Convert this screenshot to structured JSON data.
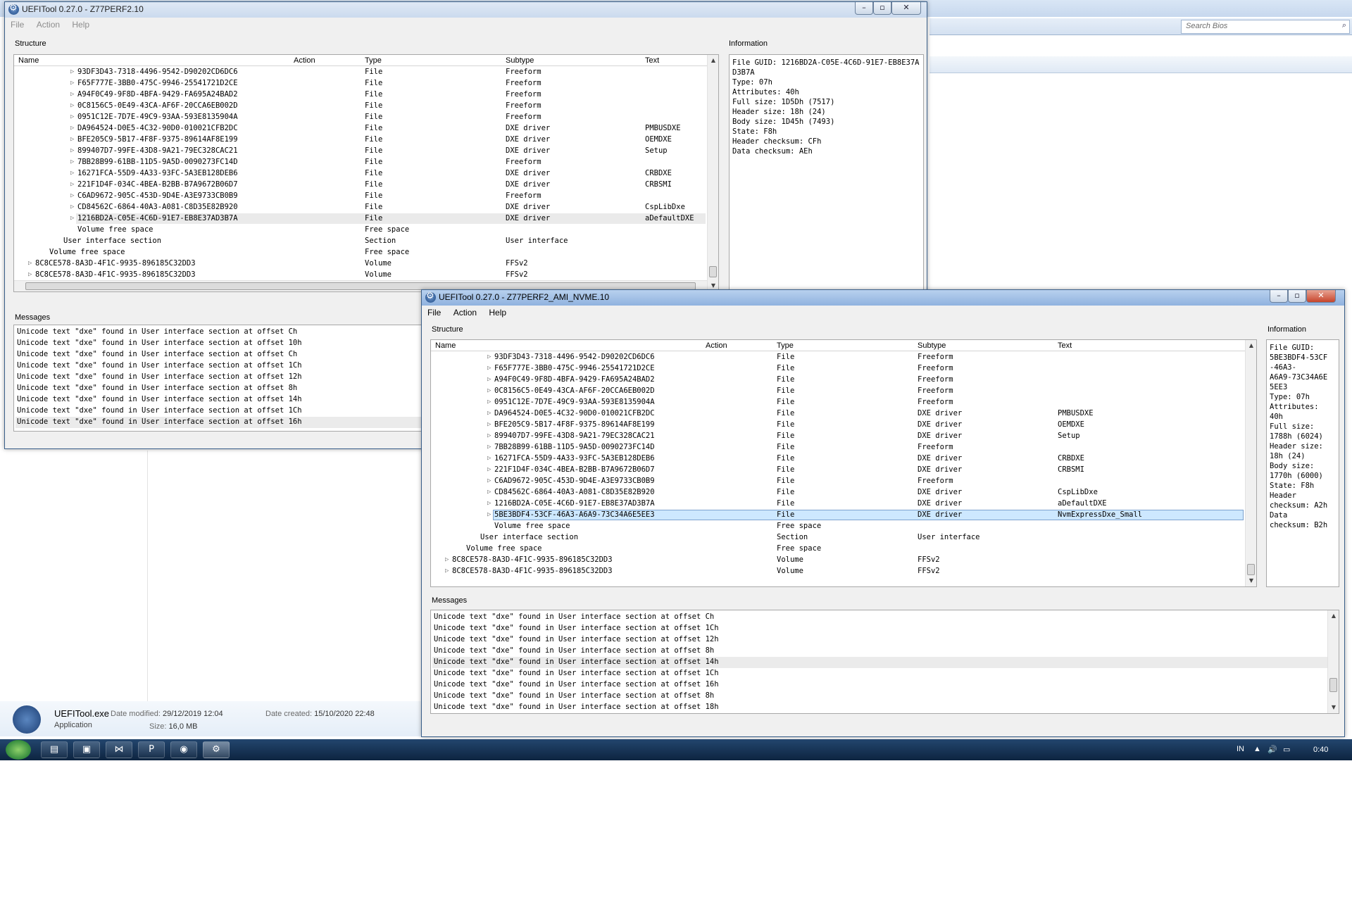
{
  "explorer": {
    "search_placeholder": "Search Bios",
    "details": {
      "file_name": "UEFITool.exe",
      "date_modified_label": "Date modified:",
      "date_modified": "29/12/2019 12:04",
      "date_created_label": "Date created:",
      "date_created": "15/10/2020 22:48",
      "file_type": "Application",
      "size_label": "Size:",
      "size": "16,0 MB"
    }
  },
  "window_back": {
    "title": "UEFITool 0.27.0 - Z77PERF2.10",
    "menu": [
      "File",
      "Action",
      "Help"
    ],
    "structure_label": "Structure",
    "information_label": "Information",
    "messages_label": "Messages",
    "columns": [
      "Name",
      "Action",
      "Type",
      "Subtype",
      "Text"
    ],
    "rows": [
      {
        "indent": 4,
        "exp": true,
        "name": "93DF3D43-7318-4496-9542-D90202CD6DC6",
        "type": "File",
        "subtype": "Freeform",
        "text": ""
      },
      {
        "indent": 4,
        "exp": true,
        "name": "F65F777E-3BB0-475C-9946-25541721D2CE",
        "type": "File",
        "subtype": "Freeform",
        "text": ""
      },
      {
        "indent": 4,
        "exp": true,
        "name": "A94F0C49-9F8D-4BFA-9429-FA695A24BAD2",
        "type": "File",
        "subtype": "Freeform",
        "text": ""
      },
      {
        "indent": 4,
        "exp": true,
        "name": "0C8156C5-0E49-43CA-AF6F-20CCA6EB002D",
        "type": "File",
        "subtype": "Freeform",
        "text": ""
      },
      {
        "indent": 4,
        "exp": true,
        "name": "0951C12E-7D7E-49C9-93AA-593E8135904A",
        "type": "File",
        "subtype": "Freeform",
        "text": ""
      },
      {
        "indent": 4,
        "exp": true,
        "name": "DA964524-D0E5-4C32-90D0-010021CFB2DC",
        "type": "File",
        "subtype": "DXE driver",
        "text": "PMBUSDXE"
      },
      {
        "indent": 4,
        "exp": true,
        "name": "BFE205C9-5B17-4F8F-9375-89614AF8E199",
        "type": "File",
        "subtype": "DXE driver",
        "text": "OEMDXE"
      },
      {
        "indent": 4,
        "exp": true,
        "name": "899407D7-99FE-43D8-9A21-79EC328CAC21",
        "type": "File",
        "subtype": "DXE driver",
        "text": "Setup"
      },
      {
        "indent": 4,
        "exp": true,
        "name": "7BB28B99-61BB-11D5-9A5D-0090273FC14D",
        "type": "File",
        "subtype": "Freeform",
        "text": ""
      },
      {
        "indent": 4,
        "exp": true,
        "name": "16271FCA-55D9-4A33-93FC-5A3EB128DEB6",
        "type": "File",
        "subtype": "DXE driver",
        "text": "CRBDXE"
      },
      {
        "indent": 4,
        "exp": true,
        "name": "221F1D4F-034C-4BEA-B2BB-B7A9672B06D7",
        "type": "File",
        "subtype": "DXE driver",
        "text": "CRBSMI"
      },
      {
        "indent": 4,
        "exp": true,
        "name": "C6AD9672-905C-453D-9D4E-A3E9733CB0B9",
        "type": "File",
        "subtype": "Freeform",
        "text": ""
      },
      {
        "indent": 4,
        "exp": true,
        "name": "CD84562C-6864-40A3-A081-C8D35E82B920",
        "type": "File",
        "subtype": "DXE driver",
        "text": "CspLibDxe"
      },
      {
        "indent": 4,
        "exp": true,
        "name": "1216BD2A-C05E-4C6D-91E7-EB8E37AD3B7A",
        "type": "File",
        "subtype": "DXE driver",
        "text": "aDefaultDXE",
        "selected": true
      },
      {
        "indent": 4,
        "exp": false,
        "name": "Volume free space",
        "type": "Free space",
        "subtype": "",
        "text": ""
      },
      {
        "indent": 3,
        "exp": false,
        "name": "User interface section",
        "type": "Section",
        "subtype": "User interface",
        "text": ""
      },
      {
        "indent": 2,
        "exp": false,
        "name": "Volume free space",
        "type": "Free space",
        "subtype": "",
        "text": ""
      },
      {
        "indent": 1,
        "exp": true,
        "name": "8C8CE578-8A3D-4F1C-9935-896185C32DD3",
        "type": "Volume",
        "subtype": "FFSv2",
        "text": ""
      },
      {
        "indent": 1,
        "exp": true,
        "name": "8C8CE578-8A3D-4F1C-9935-896185C32DD3",
        "type": "Volume",
        "subtype": "FFSv2",
        "text": ""
      }
    ],
    "information": "File GUID: 1216BD2A-C05E-4C6D-91E7-EB8E37AD3B7A\nType: 07h\nAttributes: 40h\nFull size: 1D5Dh (7517)\nHeader size: 18h (24)\nBody size: 1D45h (7493)\nState: F8h\nHeader checksum: CFh\nData checksum: AEh",
    "messages": [
      "Unicode text \"dxe\" found in User interface section at offset Ch",
      "Unicode text \"dxe\" found in User interface section at offset 10h",
      "Unicode text \"dxe\" found in User interface section at offset Ch",
      "Unicode text \"dxe\" found in User interface section at offset 1Ch",
      "Unicode text \"dxe\" found in User interface section at offset 12h",
      "Unicode text \"dxe\" found in User interface section at offset 8h",
      "Unicode text \"dxe\" found in User interface section at offset 14h",
      "Unicode text \"dxe\" found in User interface section at offset 1Ch",
      "Unicode text \"dxe\" found in User interface section at offset 16h"
    ],
    "messages_highlight_index": 8
  },
  "window_front": {
    "title": "UEFITool 0.27.0 - Z77PERF2_AMI_NVME.10",
    "menu": [
      "File",
      "Action",
      "Help"
    ],
    "structure_label": "Structure",
    "information_label": "Information",
    "messages_label": "Messages",
    "columns": [
      "Name",
      "Action",
      "Type",
      "Subtype",
      "Text"
    ],
    "rows": [
      {
        "indent": 4,
        "exp": true,
        "name": "93DF3D43-7318-4496-9542-D90202CD6DC6",
        "type": "File",
        "subtype": "Freeform",
        "text": ""
      },
      {
        "indent": 4,
        "exp": true,
        "name": "F65F777E-3BB0-475C-9946-25541721D2CE",
        "type": "File",
        "subtype": "Freeform",
        "text": ""
      },
      {
        "indent": 4,
        "exp": true,
        "name": "A94F0C49-9F8D-4BFA-9429-FA695A24BAD2",
        "type": "File",
        "subtype": "Freeform",
        "text": ""
      },
      {
        "indent": 4,
        "exp": true,
        "name": "0C8156C5-0E49-43CA-AF6F-20CCA6EB002D",
        "type": "File",
        "subtype": "Freeform",
        "text": ""
      },
      {
        "indent": 4,
        "exp": true,
        "name": "0951C12E-7D7E-49C9-93AA-593E8135904A",
        "type": "File",
        "subtype": "Freeform",
        "text": ""
      },
      {
        "indent": 4,
        "exp": true,
        "name": "DA964524-D0E5-4C32-90D0-010021CFB2DC",
        "type": "File",
        "subtype": "DXE driver",
        "text": "PMBUSDXE"
      },
      {
        "indent": 4,
        "exp": true,
        "name": "BFE205C9-5B17-4F8F-9375-89614AF8E199",
        "type": "File",
        "subtype": "DXE driver",
        "text": "OEMDXE"
      },
      {
        "indent": 4,
        "exp": true,
        "name": "899407D7-99FE-43D8-9A21-79EC328CAC21",
        "type": "File",
        "subtype": "DXE driver",
        "text": "Setup"
      },
      {
        "indent": 4,
        "exp": true,
        "name": "7BB28B99-61BB-11D5-9A5D-0090273FC14D",
        "type": "File",
        "subtype": "Freeform",
        "text": ""
      },
      {
        "indent": 4,
        "exp": true,
        "name": "16271FCA-55D9-4A33-93FC-5A3EB128DEB6",
        "type": "File",
        "subtype": "DXE driver",
        "text": "CRBDXE"
      },
      {
        "indent": 4,
        "exp": true,
        "name": "221F1D4F-034C-4BEA-B2BB-B7A9672B06D7",
        "type": "File",
        "subtype": "DXE driver",
        "text": "CRBSMI"
      },
      {
        "indent": 4,
        "exp": true,
        "name": "C6AD9672-905C-453D-9D4E-A3E9733CB0B9",
        "type": "File",
        "subtype": "Freeform",
        "text": ""
      },
      {
        "indent": 4,
        "exp": true,
        "name": "CD84562C-6864-40A3-A081-C8D35E82B920",
        "type": "File",
        "subtype": "DXE driver",
        "text": "CspLibDxe"
      },
      {
        "indent": 4,
        "exp": true,
        "name": "1216BD2A-C05E-4C6D-91E7-EB8E37AD3B7A",
        "type": "File",
        "subtype": "DXE driver",
        "text": "aDefaultDXE"
      },
      {
        "indent": 4,
        "exp": true,
        "name": "5BE3BDF4-53CF-46A3-A6A9-73C34A6E5EE3",
        "type": "File",
        "subtype": "DXE driver",
        "text": "NvmExpressDxe_Small",
        "selected": true
      },
      {
        "indent": 4,
        "exp": false,
        "name": "Volume free space",
        "type": "Free space",
        "subtype": "",
        "text": ""
      },
      {
        "indent": 3,
        "exp": false,
        "name": "User interface section",
        "type": "Section",
        "subtype": "User interface",
        "text": ""
      },
      {
        "indent": 2,
        "exp": false,
        "name": "Volume free space",
        "type": "Free space",
        "subtype": "",
        "text": ""
      },
      {
        "indent": 1,
        "exp": true,
        "name": "8C8CE578-8A3D-4F1C-9935-896185C32DD3",
        "type": "Volume",
        "subtype": "FFSv2",
        "text": ""
      },
      {
        "indent": 1,
        "exp": true,
        "name": "8C8CE578-8A3D-4F1C-9935-896185C32DD3",
        "type": "Volume",
        "subtype": "FFSv2",
        "text": ""
      }
    ],
    "information": "File GUID:\n5BE3BDF4-53CF\n-46A3-\nA6A9-73C34A6E\n5EE3\nType: 07h\nAttributes:\n40h\nFull size:\n1788h (6024)\nHeader size:\n18h (24)\nBody size:\n1770h (6000)\nState: F8h\nHeader\nchecksum: A2h\nData\nchecksum: B2h",
    "messages": [
      "Unicode text \"dxe\" found in User interface section at offset Ch",
      "Unicode text \"dxe\" found in User interface section at offset 1Ch",
      "Unicode text \"dxe\" found in User interface section at offset 12h",
      "Unicode text \"dxe\" found in User interface section at offset 8h",
      "Unicode text \"dxe\" found in User interface section at offset 14h",
      "Unicode text \"dxe\" found in User interface section at offset 1Ch",
      "Unicode text \"dxe\" found in User interface section at offset 16h",
      "Unicode text \"dxe\" found in User interface section at offset 8h",
      "Unicode text \"dxe\" found in User interface section at offset 18h"
    ],
    "messages_highlight_index": 4
  },
  "taskbar": {
    "language": "IN",
    "clock": "0:40",
    "buttons": [
      {
        "name": "explorer-taskbar-button",
        "glyph": "▤",
        "active": false
      },
      {
        "name": "media-center-taskbar-button",
        "glyph": "▣",
        "active": false
      },
      {
        "name": "visual-studio-taskbar-button",
        "glyph": "⋈",
        "active": false
      },
      {
        "name": "powerpoint-taskbar-button",
        "glyph": "P",
        "active": false
      },
      {
        "name": "chrome-taskbar-button",
        "glyph": "◉",
        "active": false
      },
      {
        "name": "uefitool-taskbar-button",
        "glyph": "⚙",
        "active": true
      }
    ]
  }
}
